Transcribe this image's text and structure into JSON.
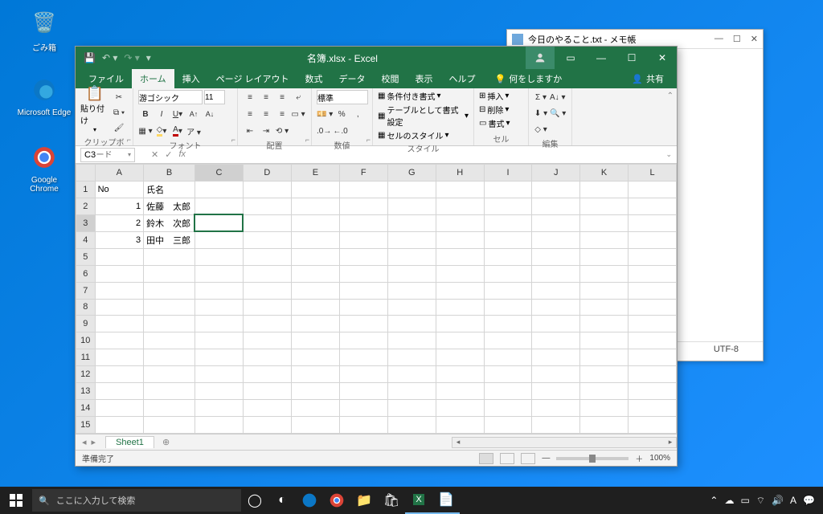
{
  "desktop": {
    "recycle": "ごみ箱",
    "edge": "Microsoft Edge",
    "chrome": "Google Chrome"
  },
  "notepad": {
    "title": "今日のやること.txt - メモ帳",
    "encoding": "UTF-8"
  },
  "excel": {
    "title": "名簿.xlsx - Excel",
    "menu": {
      "file": "ファイル",
      "home": "ホーム",
      "insert": "挿入",
      "pageLayout": "ページ レイアウト",
      "formulas": "数式",
      "data": "データ",
      "review": "校閲",
      "view": "表示",
      "help": "ヘルプ",
      "tellme": "何をしますか",
      "share": "共有"
    },
    "ribbon": {
      "clipboard": {
        "paste": "貼り付け",
        "label": "クリップボード"
      },
      "font": {
        "name": "游ゴシック",
        "size": "11",
        "label": "フォント"
      },
      "align": {
        "label": "配置"
      },
      "number": {
        "format": "標準",
        "label": "数値"
      },
      "styles": {
        "cond": "条件付き書式",
        "tbl": "テーブルとして書式設定",
        "cell": "セルのスタイル",
        "label": "スタイル"
      },
      "cells": {
        "insert": "挿入",
        "delete": "削除",
        "format": "書式",
        "label": "セル"
      },
      "editing": {
        "label": "編集"
      }
    },
    "namebox": "C3",
    "columns": [
      "A",
      "B",
      "C",
      "D",
      "E",
      "F",
      "G",
      "H",
      "I",
      "J",
      "K",
      "L"
    ],
    "rows": [
      {
        "r": 1,
        "A": "No",
        "B": "氏名"
      },
      {
        "r": 2,
        "A": "1",
        "B": "佐藤　太郎"
      },
      {
        "r": 3,
        "A": "2",
        "B": "鈴木　次郎"
      },
      {
        "r": 4,
        "A": "3",
        "B": "田中　三郎"
      }
    ],
    "selectedCell": "C3",
    "sheetTab": "Sheet1",
    "status": "準備完了",
    "zoom": "100%"
  },
  "taskbar": {
    "searchPlaceholder": "ここに入力して検索",
    "ime": "A"
  }
}
